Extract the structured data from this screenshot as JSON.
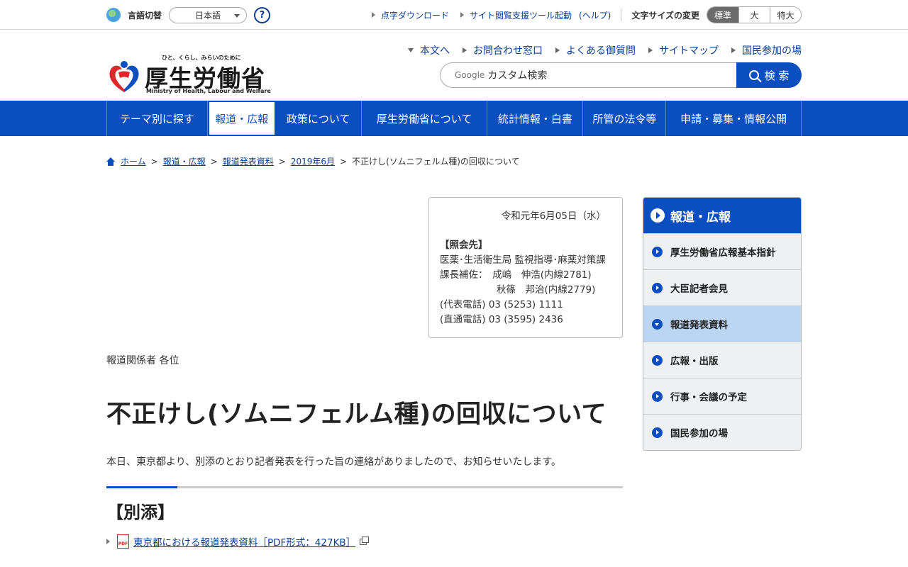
{
  "util": {
    "lang_label": "言語切替",
    "lang_value": "日本語",
    "help": "?",
    "links": [
      "点字ダウンロード",
      "サイト閲覧支援ツール起動"
    ],
    "help_link": "(ヘルプ)",
    "font_size_label": "文字サイズの変更",
    "font_sizes": [
      "標準",
      "大",
      "特大"
    ]
  },
  "logo": {
    "tagline": "ひと、くらし、みらいのために",
    "name": "厚生労働省",
    "english": "Ministry of Health, Labour and Welfare"
  },
  "header_links": [
    "本文へ",
    "お問合わせ窓口",
    "よくある御質問",
    "サイトマップ",
    "国民参加の場"
  ],
  "search": {
    "google": "Google",
    "placeholder": "カスタム検索",
    "button": "検 索"
  },
  "nav": [
    "テーマ別に探す",
    "報道・広報",
    "政策について",
    "厚生労働省について",
    "統計情報・白書",
    "所管の法令等",
    "申請・募集・情報公開"
  ],
  "breadcrumb": [
    "ホーム",
    "報道・広報",
    "報道発表資料",
    "2019年6月",
    "不正けし(ソムニフェルム種)の回収について"
  ],
  "contact": {
    "date": "令和元年6月05日（水）",
    "heading": "【照会先】",
    "dept": "医薬･生活衛生局 監視指導･麻薬対策課",
    "line1": "課長補佐：　成嶋　伸浩(内線2781)",
    "line2": "秋篠　邦治(内線2779)",
    "phone_main": "(代表電話) 03 (5253) 1111",
    "phone_direct": "(直通電話) 03 (3595) 2436"
  },
  "addressee": "報道関係者 各位",
  "title": "不正けし(ソムニフェルム種)の回収について",
  "lead": "本日、東京都より、別添のとおり記者発表を行った旨の連絡がありましたので、お知らせいたします。",
  "attachment_heading": "【別添】",
  "attachment": {
    "pdf_icon": "PDF",
    "label": "東京都における報道発表資料［PDF形式：427KB］"
  },
  "side": {
    "heading": "報道・広報",
    "items": [
      "厚生労働省広報基本指針",
      "大臣記者会見",
      "報道発表資料",
      "広報・出版",
      "行事・会議の予定",
      "国民参加の場"
    ]
  },
  "colors": {
    "brand_blue": "#0b4ebf",
    "link": "#0a3d91",
    "active_side": "#bcd5f2"
  }
}
